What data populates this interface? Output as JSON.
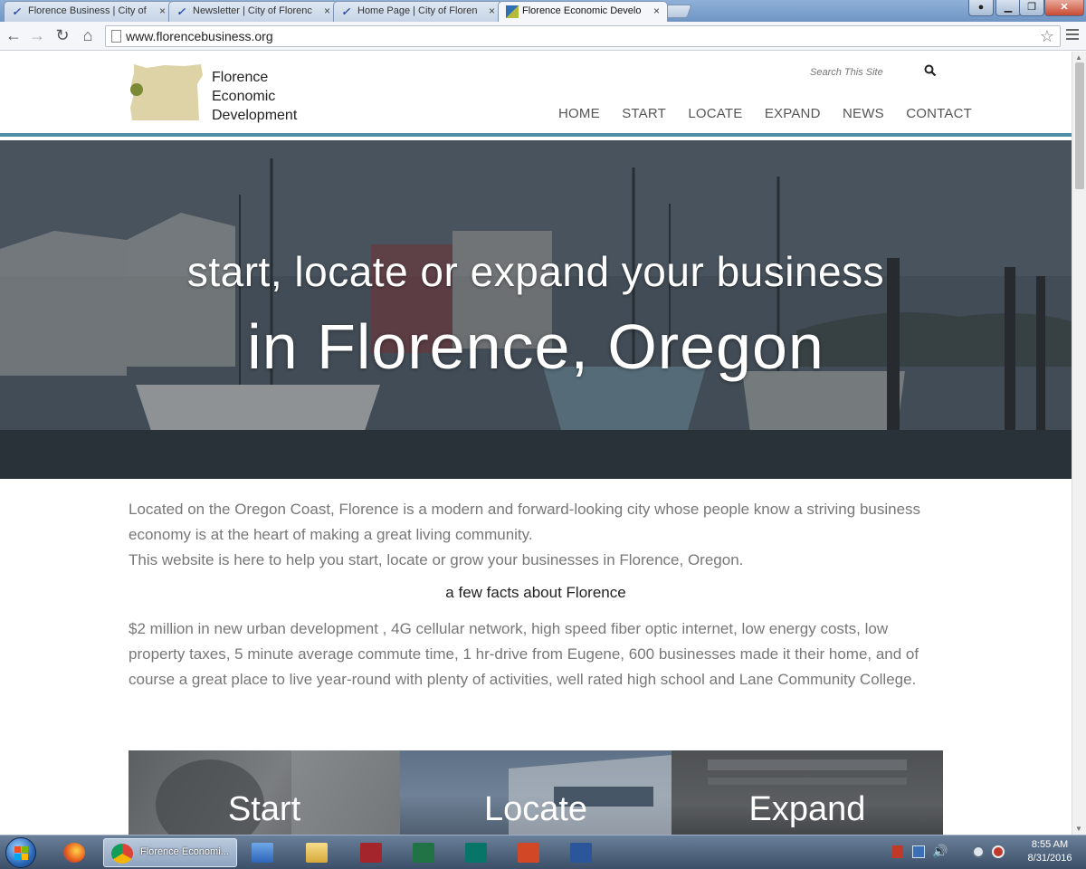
{
  "browser": {
    "tabs": [
      {
        "title": "Florence Business | City of",
        "close": "×"
      },
      {
        "title": "Newsletter | City of Florence",
        "close": "×"
      },
      {
        "title": "Home Page | City of Florence",
        "close": "×"
      },
      {
        "title": "Florence Economic Develo",
        "close": "×"
      }
    ],
    "url": "www.florencebusiness.org",
    "nav": {
      "back": "←",
      "forward": "→",
      "reload": "↻",
      "home": "⌂"
    },
    "star": "☆"
  },
  "site": {
    "logo": {
      "line1": "Florence",
      "line2": "Economic",
      "line3": "Development",
      "map_color": "#ddd3a6",
      "dot_color": "#7a8a35"
    },
    "search": {
      "placeholder": "Search This Site"
    },
    "nav": {
      "home": "HOME",
      "start": "START",
      "locate": "LOCATE",
      "expand": "EXPAND",
      "news": "NEWS",
      "contact": "CONTACT"
    },
    "accent_color": "#4d8ea6"
  },
  "hero": {
    "line1": "start, locate or expand your business",
    "line2": "in Florence, Oregon"
  },
  "content": {
    "intro_p1": "Located on the Oregon Coast, Florence is a modern and forward-looking city whose people know a striving business economy is at the heart of making a great living community.",
    "intro_p2": "This website is here to help you start, locate or grow your businesses in Florence, Oregon.",
    "facts_title": "a few facts about Florence",
    "facts_text": "$2 million in new urban development , 4G cellular network, high speed fiber optic internet, low energy costs, low property taxes, 5 minute average commute time, 1 hr-drive from Eugene, 600 businesses made it their home, and of course a great place to live year-round with plenty of activities, well rated high school and Lane Community College."
  },
  "cards": {
    "start": "Start",
    "locate": "Locate",
    "expand": "Expand"
  },
  "taskbar": {
    "active_app": "Florence Economi...",
    "time": "8:55 AM",
    "date": "8/31/2016"
  }
}
